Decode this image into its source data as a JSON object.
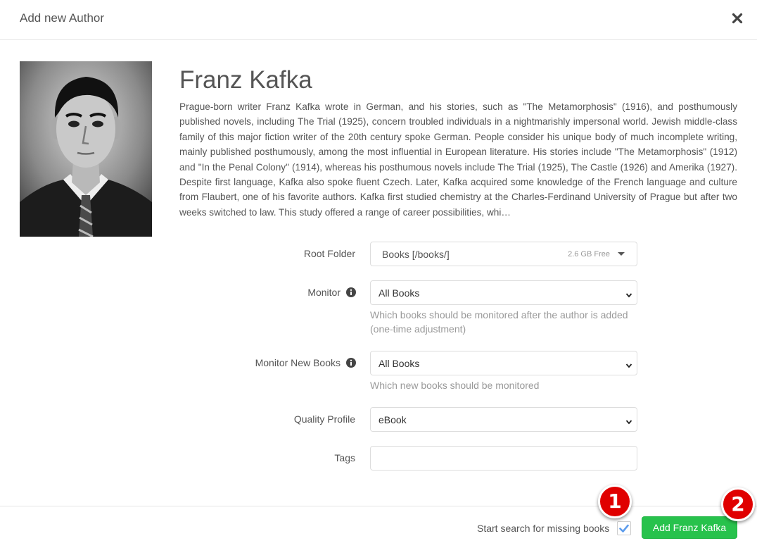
{
  "modal": {
    "title": "Add new Author"
  },
  "author": {
    "name": "Franz Kafka",
    "overview": "Prague-born writer Franz Kafka wrote in German, and his stories, such as \"The Metamorphosis\" (1916), and posthumously published novels, including The Trial (1925), concern troubled individuals in a nightmarishly impersonal world.  Jewish middle-class family of this major fiction writer of the 20th century spoke German. People consider his unique body of much incomplete writing, mainly published posthumously, among the most influential in European literature.    His stories include \"The Metamorphosis\" (1912) and \"In the Penal Colony\" (1914), whereas his posthumous novels include The Trial (1925), The Castle (1926) and Amerika (1927).  Despite first language, Kafka also spoke fluent Czech. Later, Kafka acquired some knowledge of the French language and culture from Flaubert, one of his favorite authors.   Kafka first studied chemistry at the Charles-Ferdinand University of Prague but after two weeks switched to law. This study offered a range of career possibilities, whi…"
  },
  "form": {
    "root_folder": {
      "label": "Root Folder",
      "value": "Books [/books/]",
      "free_space": "2.6 GB Free"
    },
    "monitor": {
      "label": "Monitor",
      "value": "All Books",
      "help": "Which books should be monitored after the author is added",
      "help2": "(one-time adjustment)"
    },
    "monitor_new_books": {
      "label": "Monitor New Books",
      "value": "All Books",
      "help": "Which new books should be monitored"
    },
    "quality_profile": {
      "label": "Quality Profile",
      "value": "eBook"
    },
    "tags": {
      "label": "Tags",
      "value": ""
    }
  },
  "footer": {
    "search_label": "Start search for missing books",
    "search_checked": true,
    "add_button": "Add Franz Kafka"
  },
  "annotations": {
    "badge_1": "1",
    "badge_2": "2"
  },
  "colors": {
    "primary_green": "#27c24c",
    "checkbox_blue": "#5d9cec",
    "badge_red": "#e00000"
  }
}
